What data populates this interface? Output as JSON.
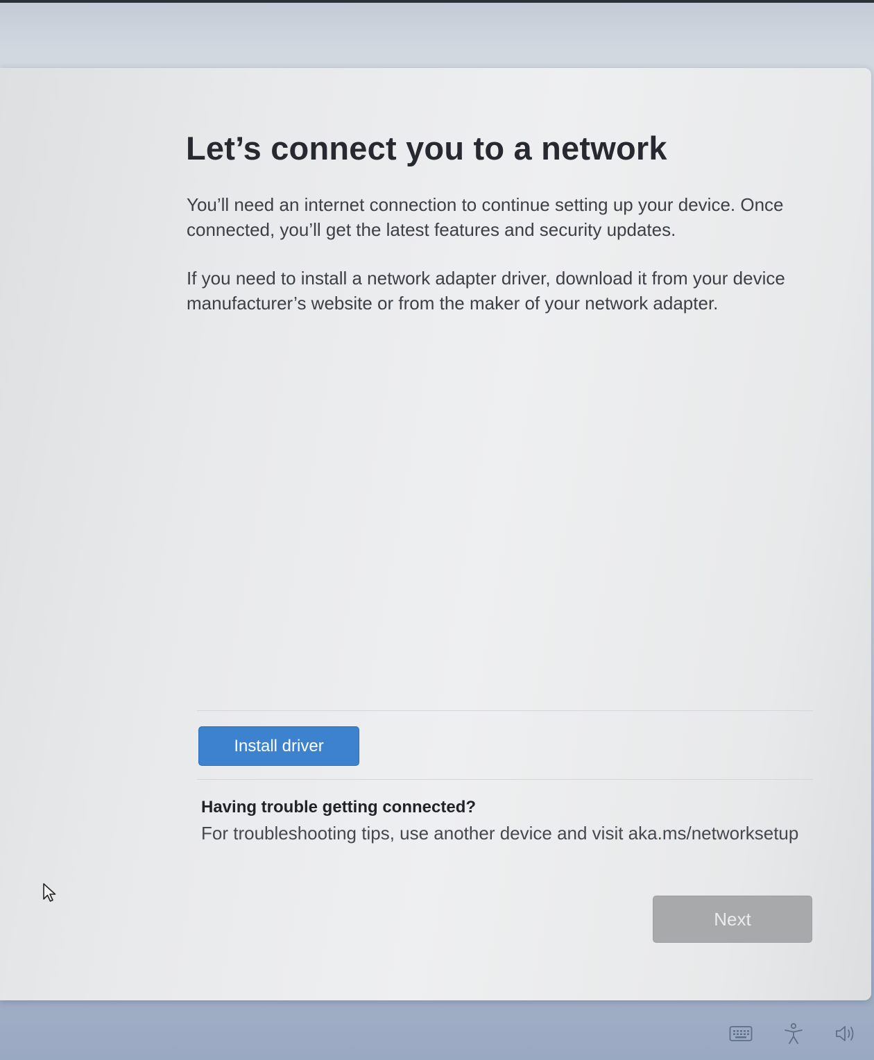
{
  "oobe": {
    "title": "Let’s connect you to a network",
    "paragraph_1": "You’ll need an internet connection to continue setting up your device. Once connected, you’ll get the latest features and security updates.",
    "paragraph_2": "If you need to install a network adapter driver, download it from your device manufacturer’s website or from the maker of your network adapter.",
    "install_driver_label": "Install driver",
    "trouble_heading": "Having trouble getting connected?",
    "trouble_text": "For troubleshooting tips, use another device and visit aka.ms/networksetup",
    "next_label": "Next",
    "next_enabled": false
  },
  "taskbar": {
    "icons": [
      "keyboard-icon",
      "accessibility-icon",
      "volume-icon"
    ]
  },
  "colors": {
    "primary_button": "#3c82cf",
    "disabled_button": "#a7a9ab",
    "title_text": "#262a30"
  }
}
